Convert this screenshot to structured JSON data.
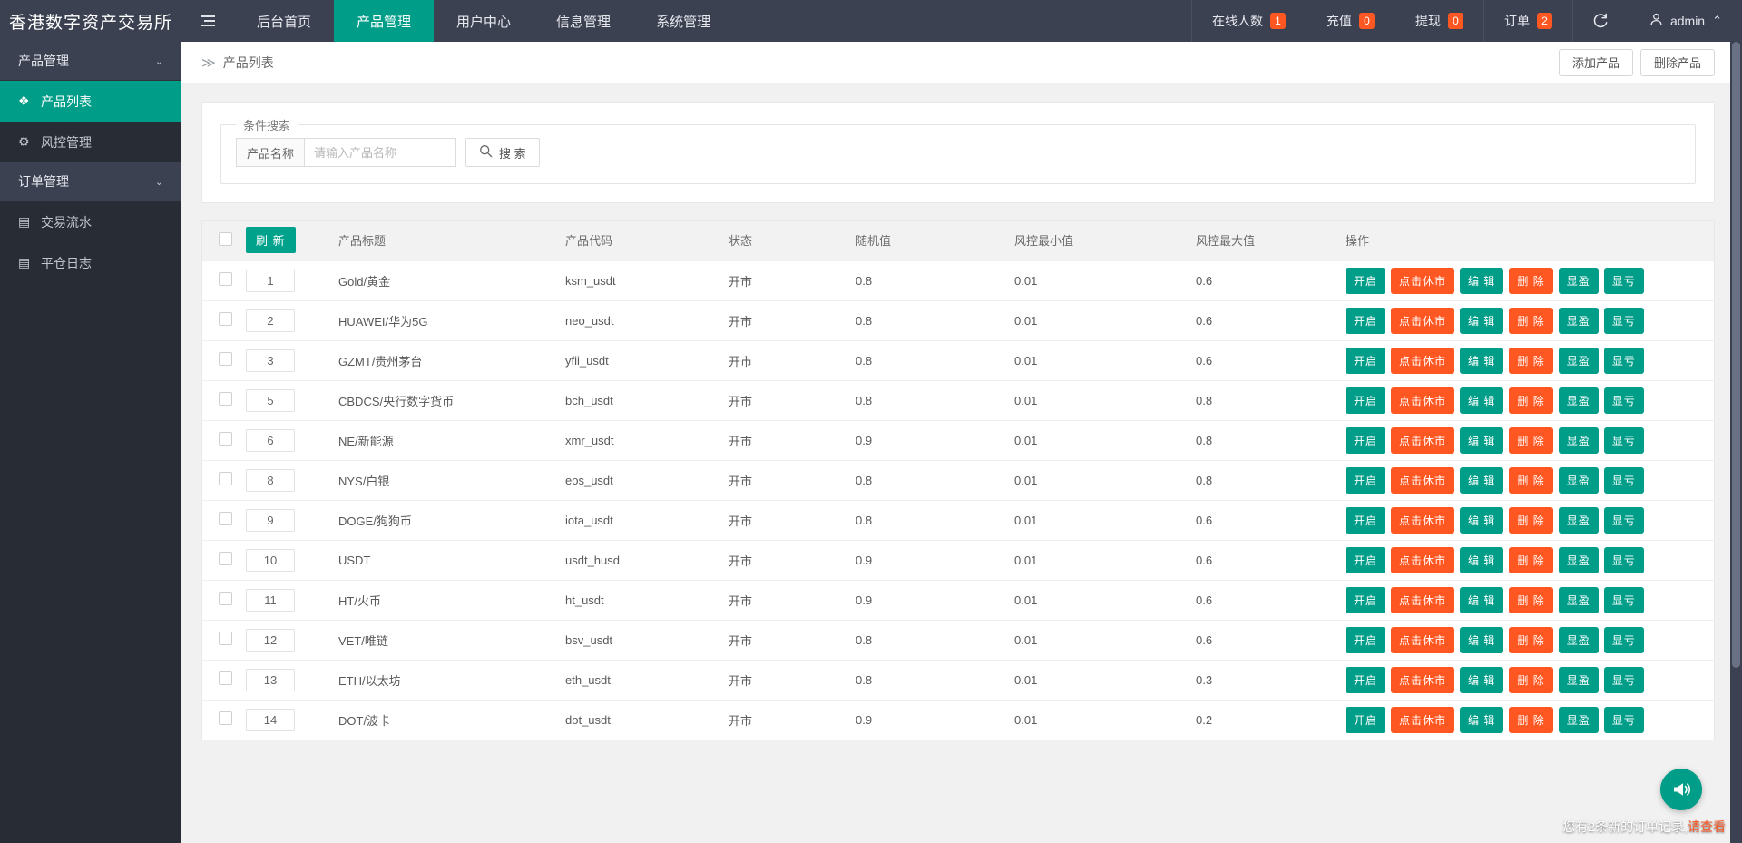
{
  "topbar": {
    "brand": "香港数字资产交易所",
    "menu_icon": "hamburger-icon",
    "nav": [
      {
        "label": "后台首页",
        "active": false
      },
      {
        "label": "产品管理",
        "active": true
      },
      {
        "label": "用户中心",
        "active": false
      },
      {
        "label": "信息管理",
        "active": false
      },
      {
        "label": "系统管理",
        "active": false
      }
    ],
    "stats": [
      {
        "label": "在线人数",
        "count": "1"
      },
      {
        "label": "充值",
        "count": "0"
      },
      {
        "label": "提现",
        "count": "0"
      },
      {
        "label": "订单",
        "count": "2"
      }
    ],
    "refresh_icon": "refresh-icon",
    "user": {
      "name": "admin",
      "avatar_icon": "user-icon",
      "chevron": "⌃"
    }
  },
  "sidebar": {
    "groups": [
      {
        "label": "产品管理",
        "chevron": "⌄",
        "items": [
          {
            "label": "产品列表",
            "icon": "layers-icon",
            "glyph": "❖",
            "active": true
          },
          {
            "label": "风控管理",
            "icon": "gear-icon",
            "glyph": "⚙",
            "active": false
          }
        ]
      },
      {
        "label": "订单管理",
        "chevron": "⌄",
        "items": [
          {
            "label": "交易流水",
            "icon": "clipboard-icon",
            "glyph": "▤",
            "active": false
          },
          {
            "label": "平仓日志",
            "icon": "clipboard-icon",
            "glyph": "▤",
            "active": false
          }
        ]
      }
    ]
  },
  "breadcrumb": {
    "arrows": "≫",
    "title": "产品列表"
  },
  "page_actions": {
    "add_label": "添加产品",
    "delete_label": "删除产品"
  },
  "search": {
    "legend": "条件搜索",
    "field_label": "产品名称",
    "placeholder": "请输入产品名称",
    "value": "",
    "button_label": "搜 索",
    "button_icon": "search-icon"
  },
  "table": {
    "refresh_label": "刷 新",
    "columns": [
      "产品标题",
      "产品代码",
      "状态",
      "随机值",
      "风控最小值",
      "风控最大值",
      "操作"
    ],
    "op_buttons": [
      {
        "label": "开启",
        "color": "teal"
      },
      {
        "label": "点击休市",
        "color": "orange"
      },
      {
        "label": "编 辑",
        "color": "teal"
      },
      {
        "label": "删 除",
        "color": "orange"
      },
      {
        "label": "显盈",
        "color": "teal"
      },
      {
        "label": "显亏",
        "color": "teal"
      }
    ],
    "rows": [
      {
        "id": "1",
        "title": "Gold/黄金",
        "code": "ksm_usdt",
        "state": "开市",
        "random": "0.8",
        "min": "0.01",
        "max": "0.6"
      },
      {
        "id": "2",
        "title": "HUAWEI/华为5G",
        "code": "neo_usdt",
        "state": "开市",
        "random": "0.8",
        "min": "0.01",
        "max": "0.6"
      },
      {
        "id": "3",
        "title": "GZMT/贵州茅台",
        "code": "yfii_usdt",
        "state": "开市",
        "random": "0.8",
        "min": "0.01",
        "max": "0.6"
      },
      {
        "id": "5",
        "title": "CBDCS/央行数字货币",
        "code": "bch_usdt",
        "state": "开市",
        "random": "0.8",
        "min": "0.01",
        "max": "0.8"
      },
      {
        "id": "6",
        "title": "NE/新能源",
        "code": "xmr_usdt",
        "state": "开市",
        "random": "0.9",
        "min": "0.01",
        "max": "0.8"
      },
      {
        "id": "8",
        "title": "NYS/白银",
        "code": "eos_usdt",
        "state": "开市",
        "random": "0.8",
        "min": "0.01",
        "max": "0.8"
      },
      {
        "id": "9",
        "title": "DOGE/狗狗币",
        "code": "iota_usdt",
        "state": "开市",
        "random": "0.8",
        "min": "0.01",
        "max": "0.6"
      },
      {
        "id": "10",
        "title": "USDT",
        "code": "usdt_husd",
        "state": "开市",
        "random": "0.9",
        "min": "0.01",
        "max": "0.6"
      },
      {
        "id": "11",
        "title": "HT/火币",
        "code": "ht_usdt",
        "state": "开市",
        "random": "0.9",
        "min": "0.01",
        "max": "0.6"
      },
      {
        "id": "12",
        "title": "VET/唯链",
        "code": "bsv_usdt",
        "state": "开市",
        "random": "0.8",
        "min": "0.01",
        "max": "0.6"
      },
      {
        "id": "13",
        "title": "ETH/以太坊",
        "code": "eth_usdt",
        "state": "开市",
        "random": "0.8",
        "min": "0.01",
        "max": "0.3"
      },
      {
        "id": "14",
        "title": "DOT/波卡",
        "code": "dot_usdt",
        "state": "开市",
        "random": "0.9",
        "min": "0.01",
        "max": "0.2"
      }
    ]
  },
  "toast": {
    "text": "您有2条新的订单记录,",
    "link": "请查看"
  },
  "float_button": {
    "icon": "megaphone-icon"
  },
  "colors": {
    "teal": "#009e88",
    "orange": "#ff5722",
    "dark": "#3c4152",
    "sidebar_dark": "#282c35"
  }
}
